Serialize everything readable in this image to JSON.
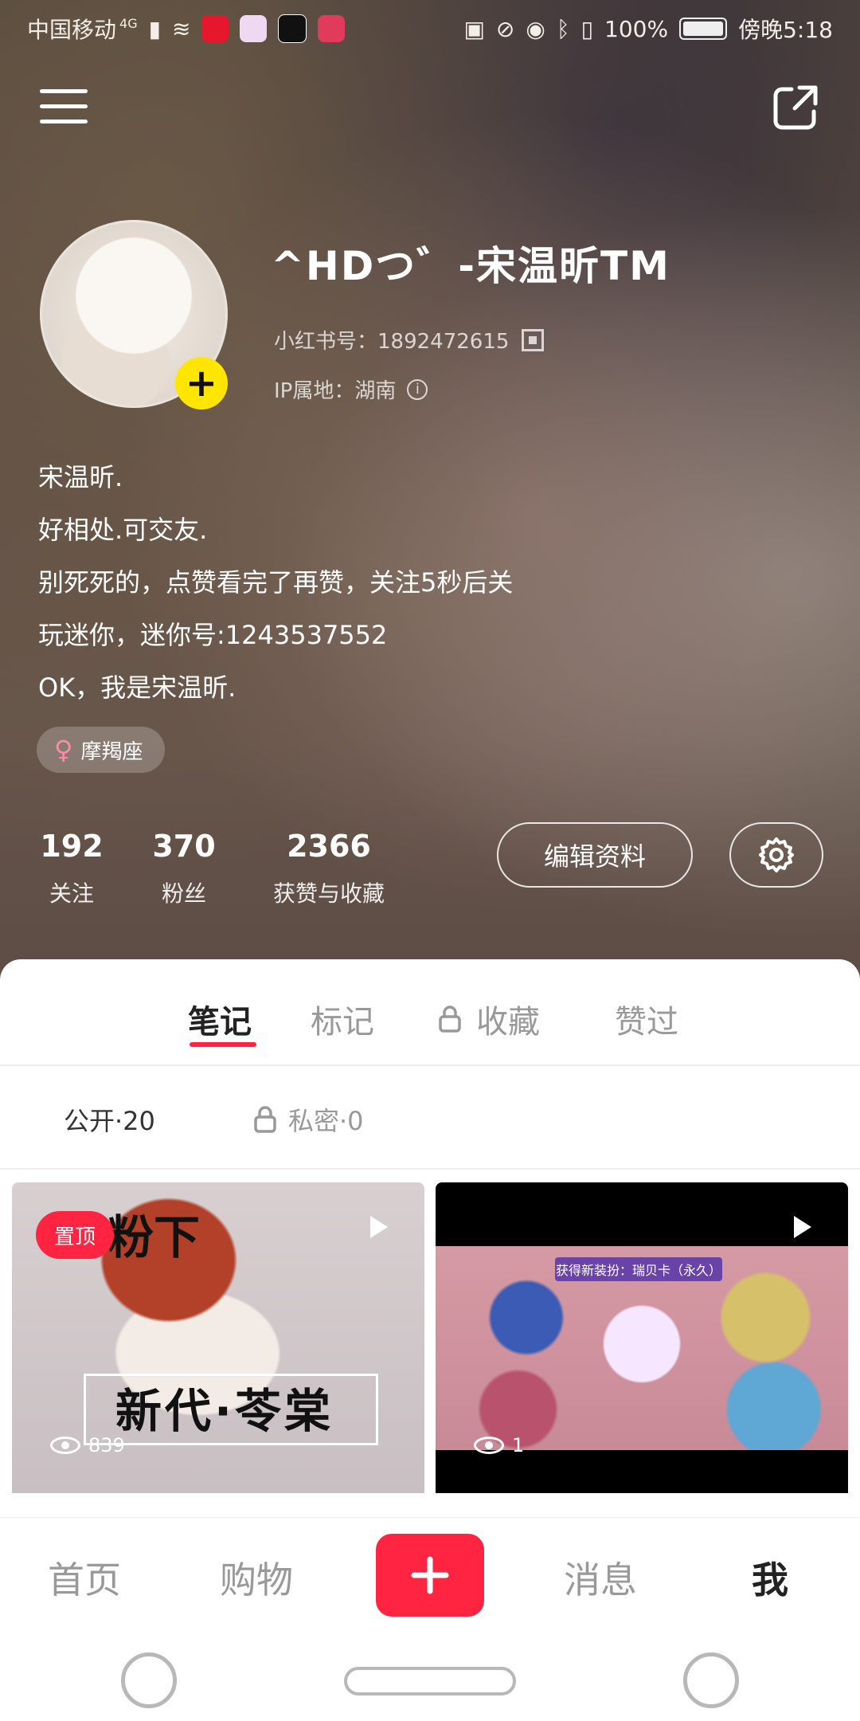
{
  "status_bar": {
    "carrier": "中国移动",
    "network": "4G",
    "battery": "100%",
    "time": "傍晚5:18"
  },
  "profile": {
    "nickname": "^HDつ゛-宋温昕TM",
    "red_id": "小红书号：1892472615",
    "ip": "IP属地：湖南",
    "bio": [
      "宋温昕.",
      "好相处.可交友.",
      "别死死的，点赞看完了再赞，关注5秒后关",
      "玩迷你，迷你号:1243537552",
      "OK，我是宋温昕."
    ],
    "tag": "摩羯座",
    "stats": [
      {
        "num": "192",
        "label": "关注"
      },
      {
        "num": "370",
        "label": "粉丝"
      },
      {
        "num": "2366",
        "label": "获赞与收藏"
      }
    ],
    "edit_label": "编辑资料"
  },
  "tabs": [
    {
      "label": "笔记",
      "active": true
    },
    {
      "label": "标记",
      "active": false
    },
    {
      "label": "收藏",
      "active": false,
      "locked": true
    },
    {
      "label": "赞过",
      "active": false
    }
  ],
  "subtabs": {
    "public": "公开·20",
    "private": "私密·0"
  },
  "notes": [
    {
      "pin": "置顶",
      "title_top": "粉下",
      "title_big": "新代·苓棠",
      "views": "839"
    },
    {
      "banner": "获得新装扮：瑞贝卡（永久）",
      "views": "1"
    }
  ],
  "bottom_nav": {
    "home": "首页",
    "shop": "购物",
    "messages": "消息",
    "me": "我"
  },
  "colors": {
    "accent": "#ff2442",
    "avatar_badge": "#ffe500"
  }
}
